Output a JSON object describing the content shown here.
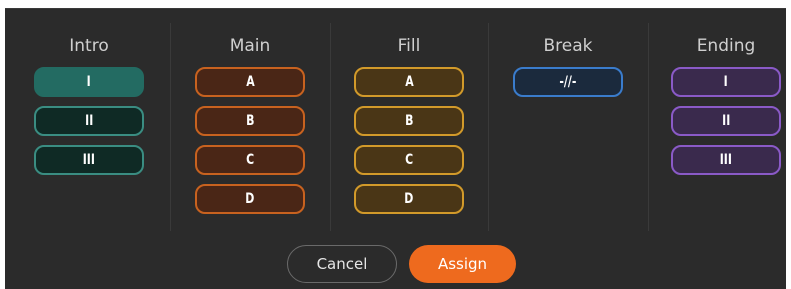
{
  "columns": [
    {
      "title": "Intro",
      "pads": [
        "I",
        "II",
        "III"
      ],
      "selected_index": 0,
      "accent": "#3a8d82"
    },
    {
      "title": "Main",
      "pads": [
        "A",
        "B",
        "C",
        "D"
      ],
      "accent": "#c8621f"
    },
    {
      "title": "Fill",
      "pads": [
        "A",
        "B",
        "C",
        "D"
      ],
      "accent": "#d29a2a"
    },
    {
      "title": "Break",
      "pads": [
        "-//-"
      ],
      "accent": "#3a7ccc"
    },
    {
      "title": "Ending",
      "pads": [
        "I",
        "II",
        "III"
      ],
      "accent": "#8a5ac7"
    }
  ],
  "buttons": {
    "cancel": "Cancel",
    "assign": "Assign"
  },
  "colors": {
    "panel_background": "#2b2b2b",
    "assign_button": "#ee6a1e"
  }
}
